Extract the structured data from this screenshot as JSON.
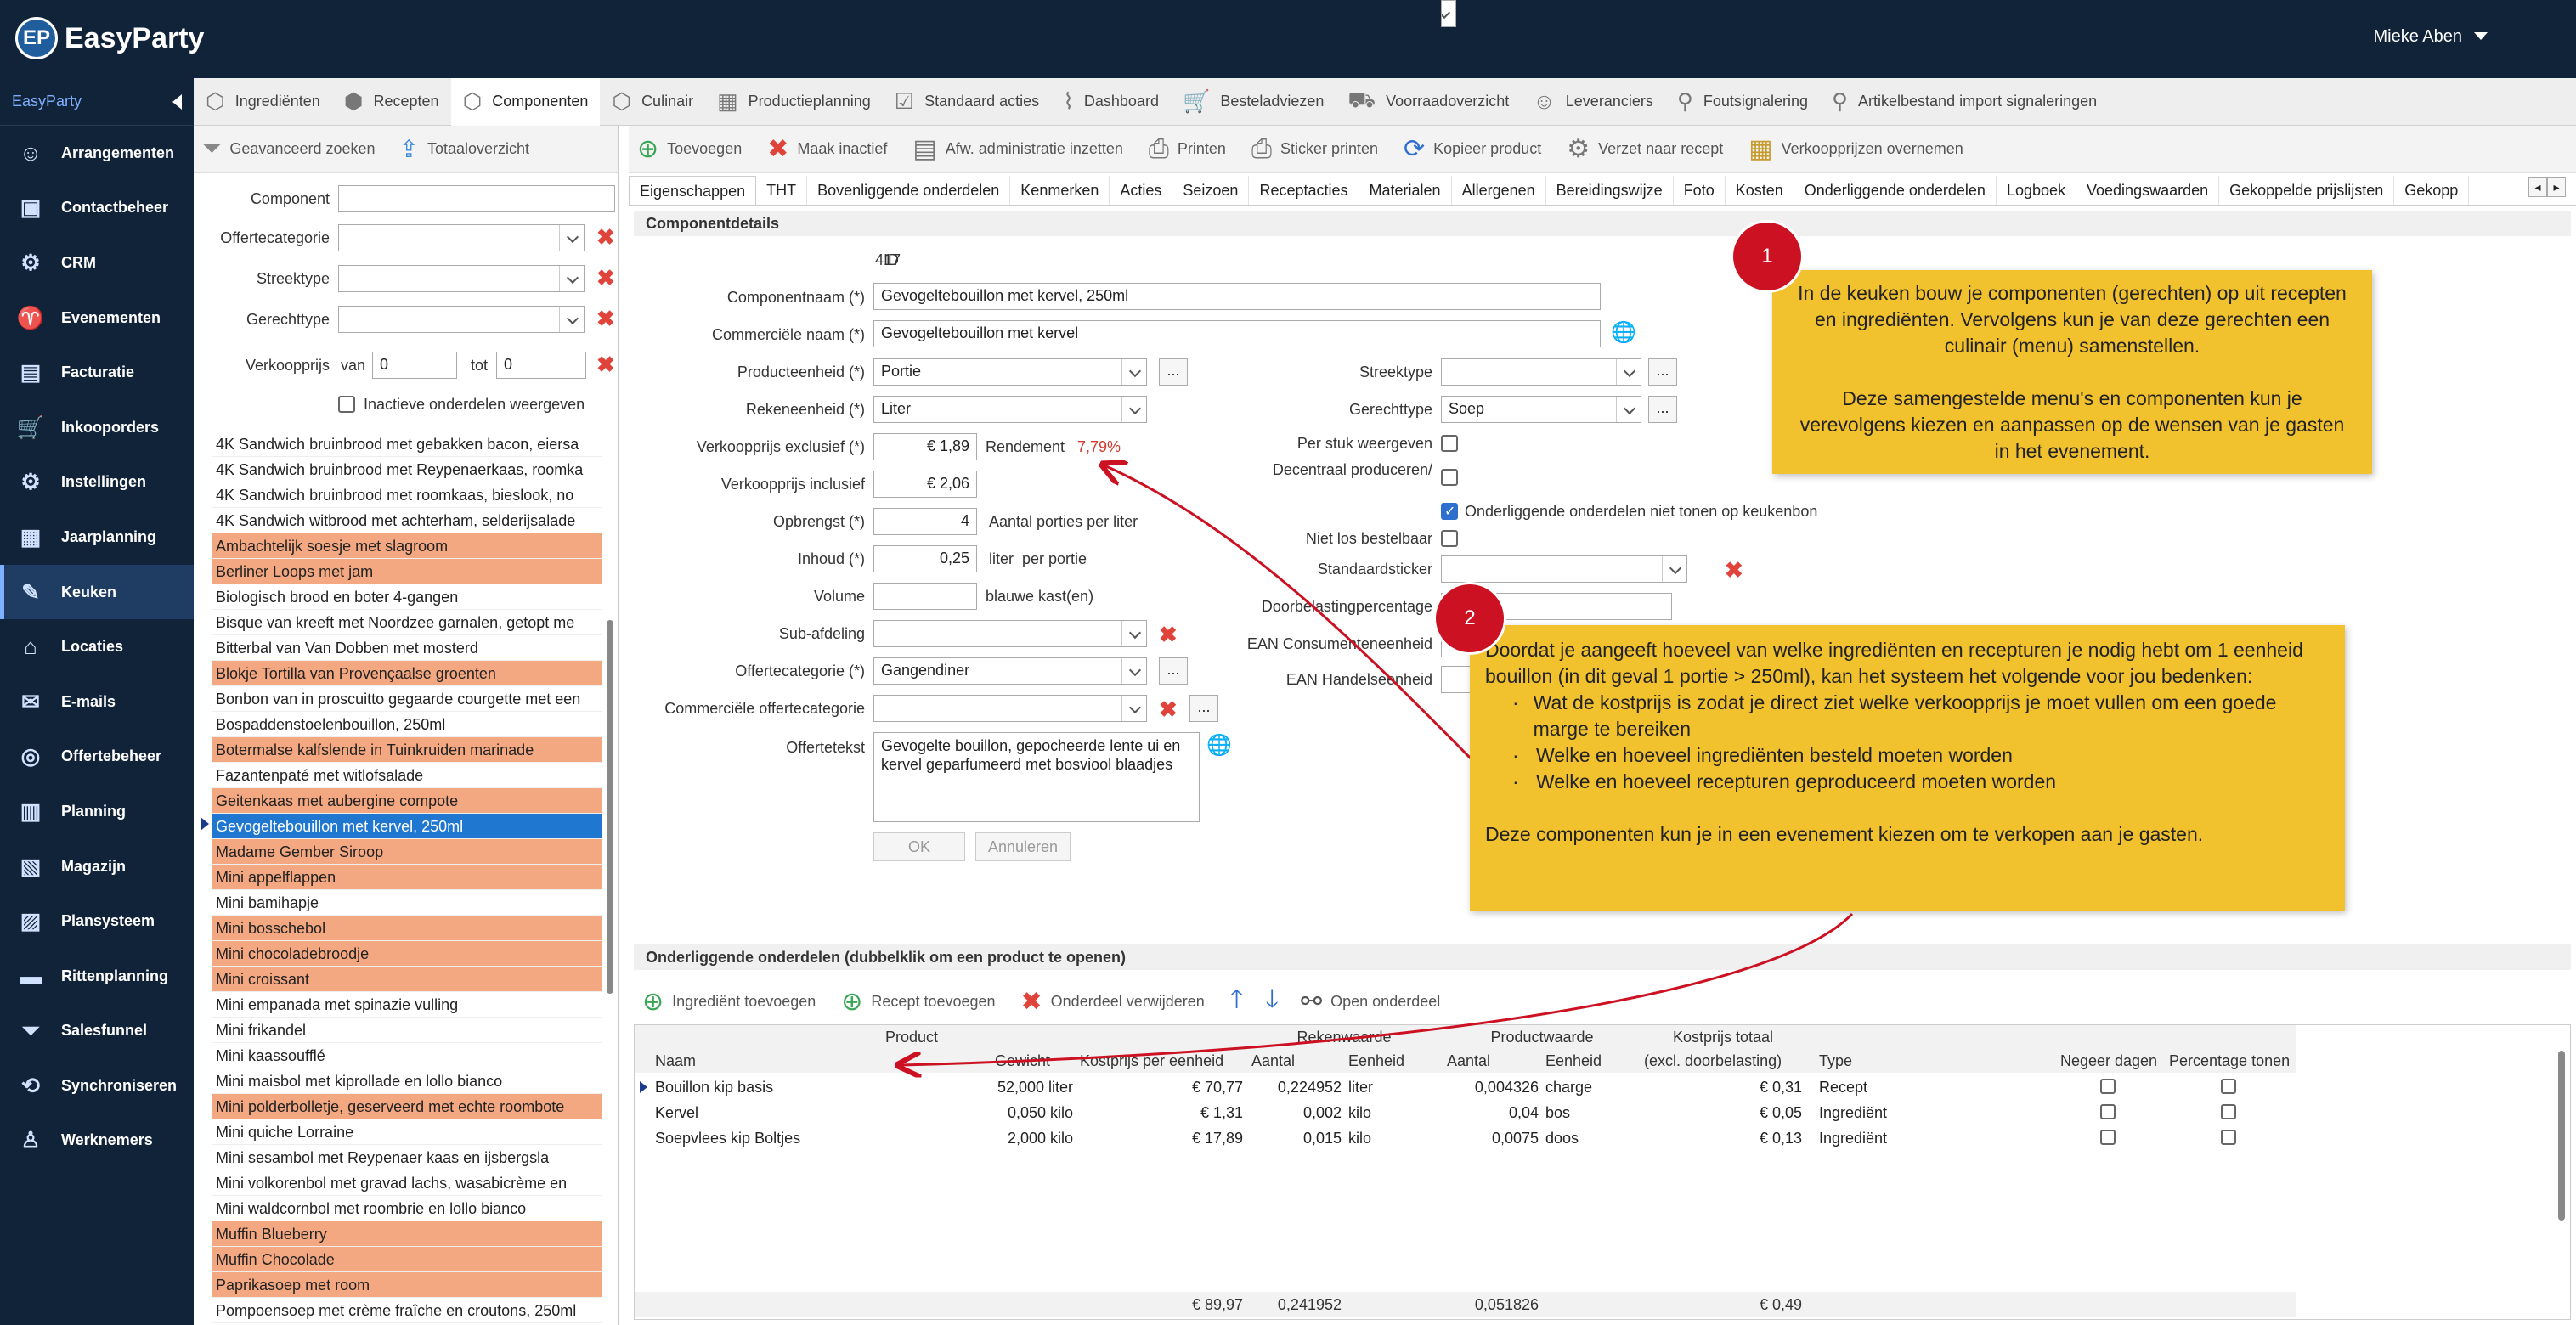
{
  "app": {
    "logo_badge": "EP",
    "logo_text": "EasyParty",
    "user": "Mieke Aben"
  },
  "sidebar": {
    "header": "EasyParty",
    "items": [
      {
        "label": "Arrangementen",
        "icon": "people-icon"
      },
      {
        "label": "Contactbeheer",
        "icon": "contact-card-icon"
      },
      {
        "label": "CRM",
        "icon": "crm-icon"
      },
      {
        "label": "Evenementen",
        "icon": "glass-icon"
      },
      {
        "label": "Facturatie",
        "icon": "invoice-icon"
      },
      {
        "label": "Inkooporders",
        "icon": "cart-icon"
      },
      {
        "label": "Instellingen",
        "icon": "gear-icon"
      },
      {
        "label": "Jaarplanning",
        "icon": "calendar-icon"
      },
      {
        "label": "Keuken",
        "icon": "knife-icon"
      },
      {
        "label": "Locaties",
        "icon": "house-icon"
      },
      {
        "label": "E-mails",
        "icon": "mail-icon"
      },
      {
        "label": "Offertebeheer",
        "icon": "quote-icon"
      },
      {
        "label": "Planning",
        "icon": "planning-icon"
      },
      {
        "label": "Magazijn",
        "icon": "box-icon"
      },
      {
        "label": "Plansysteem",
        "icon": "board-icon"
      },
      {
        "label": "Rittenplanning",
        "icon": "bus-icon"
      },
      {
        "label": "Salesfunnel",
        "icon": "funnel-icon"
      },
      {
        "label": "Synchroniseren",
        "icon": "sync-icon"
      },
      {
        "label": "Werknemers",
        "icon": "worker-icon"
      }
    ]
  },
  "module_tabs": [
    {
      "label": "Ingrediënten",
      "icon": "cube-icon"
    },
    {
      "label": "Recepten",
      "icon": "cubes-icon"
    },
    {
      "label": "Componenten",
      "icon": "cube-icon"
    },
    {
      "label": "Culinair",
      "icon": "cube-icon"
    },
    {
      "label": "Productieplanning",
      "icon": "calendar-icon"
    },
    {
      "label": "Standaard acties",
      "icon": "checklist-icon"
    },
    {
      "label": "Dashboard",
      "icon": "chart-icon"
    },
    {
      "label": "Besteladviezen",
      "icon": "cart-icon"
    },
    {
      "label": "Voorraadoverzicht",
      "icon": "forklift-icon"
    },
    {
      "label": "Leveranciers",
      "icon": "people-icon"
    },
    {
      "label": "Foutsignalering",
      "icon": "search-icon"
    },
    {
      "label": "Artikelbestand import signaleringen",
      "icon": "search-icon"
    }
  ],
  "left": {
    "tool": {
      "advanced": "Geavanceerd zoeken",
      "total": "Totaaloverzicht"
    },
    "filters": {
      "component": "Component",
      "offercat": "Offertecategorie",
      "streek": "Streektype",
      "gerecht": "Gerechttype",
      "price": "Verkoopprijs",
      "van": "van",
      "tot": "tot",
      "van_val": "0",
      "tot_val": "0",
      "inactive": "Inactieve onderdelen weergeven"
    },
    "items": [
      {
        "text": "4K Sandwich bruinbrood met gebakken bacon, eiersa",
        "hl": false
      },
      {
        "text": "4K Sandwich bruinbrood met Reypenaerkaas, roomka",
        "hl": false
      },
      {
        "text": "4K Sandwich bruinbrood met roomkaas, bieslook, no",
        "hl": false
      },
      {
        "text": "4K Sandwich witbrood met achterham, selderijsalade",
        "hl": false
      },
      {
        "text": "Ambachtelijk soesje met slagroom",
        "hl": true
      },
      {
        "text": "Berliner Loops met jam",
        "hl": true
      },
      {
        "text": "Biologisch brood en boter 4-gangen",
        "hl": false
      },
      {
        "text": "Bisque van kreeft met Noordzee garnalen, getopt me",
        "hl": false
      },
      {
        "text": "Bitterbal van Van Dobben met mosterd",
        "hl": false
      },
      {
        "text": "Blokje Tortilla van Provençaalse groenten",
        "hl": true
      },
      {
        "text": "Bonbon van in proscuitto gegaarde courgette met een",
        "hl": false
      },
      {
        "text": "Bospaddenstoelenbouillon, 250ml",
        "hl": false
      },
      {
        "text": "Botermalse kalfslende in Tuinkruiden marinade",
        "hl": true
      },
      {
        "text": "Fazantenpaté met witlofsalade",
        "hl": false
      },
      {
        "text": "Geitenkaas met aubergine compote",
        "hl": true
      },
      {
        "text": "Gevogeltebouillon met kervel, 250ml",
        "hl": false,
        "sel": true
      },
      {
        "text": "Madame Gember Siroop",
        "hl": true
      },
      {
        "text": "Mini appelflappen",
        "hl": true
      },
      {
        "text": "Mini bamihapje",
        "hl": false
      },
      {
        "text": "Mini bosschebol",
        "hl": true
      },
      {
        "text": "Mini chocoladebroodje",
        "hl": true
      },
      {
        "text": "Mini croissant",
        "hl": true
      },
      {
        "text": "Mini empanada met spinazie vulling",
        "hl": false
      },
      {
        "text": "Mini frikandel",
        "hl": false
      },
      {
        "text": "Mini kaassoufflé",
        "hl": false
      },
      {
        "text": "Mini maisbol met kiprollade en lollo bianco",
        "hl": false
      },
      {
        "text": "Mini polderbolletje, geserveerd met echte roombote",
        "hl": true
      },
      {
        "text": "Mini quiche Lorraine",
        "hl": false
      },
      {
        "text": "Mini sesambol met Reypenaer kaas en ijsbergsla",
        "hl": false
      },
      {
        "text": "Mini volkorenbol met gravad lachs, wasabicrème en",
        "hl": false
      },
      {
        "text": "Mini waldcornbol met roombrie en lollo bianco",
        "hl": false
      },
      {
        "text": "Muffin Blueberry",
        "hl": true
      },
      {
        "text": "Muffin Chocolade",
        "hl": true
      },
      {
        "text": "Paprikasoep met room",
        "hl": true
      },
      {
        "text": "Pompoensoep met crème fraîche en croutons, 250ml",
        "hl": false
      }
    ]
  },
  "toolbar": {
    "add": "Toevoegen",
    "inactive": "Maak inactief",
    "admin": "Afw. administratie inzetten",
    "print": "Printen",
    "sticker": "Sticker printen",
    "copy": "Kopieer product",
    "move": "Verzet naar recept",
    "prices": "Verkoopprijzen overnemen"
  },
  "subtabs": [
    "Eigenschappen",
    "THT",
    "Bovenliggende onderdelen",
    "Kenmerken",
    "Acties",
    "Seizoen",
    "Receptacties",
    "Materialen",
    "Allergenen",
    "Bereidingswijze",
    "Foto",
    "Kosten",
    "Onderliggende onderdelen",
    "Logboek",
    "Voedingswaarden",
    "Gekoppelde prijslijsten",
    "Gekopp"
  ],
  "details": {
    "section": "Componentdetails",
    "id_label": "ID",
    "id": "417",
    "name_label": "Componentnaam (*)",
    "name": "Gevogeltebouillon met kervel, 250ml",
    "comm_label": "Commerciële naam (*)",
    "comm": "Gevogeltebouillon met kervel",
    "prod_unit_label": "Producteenheid (*)",
    "prod_unit": "Portie",
    "calc_unit_label": "Rekeneenheid (*)",
    "calc_unit": "Liter",
    "price_ex_label": "Verkoopprijs exclusief (*)",
    "price_ex": "€ 1,89",
    "rend_label": "Rendement",
    "rend": "7,79%",
    "price_in_label": "Verkoopprijs inclusief",
    "price_in": "€ 2,06",
    "yield_label": "Opbrengst (*)",
    "yield": "4",
    "yield_unit": "Aantal porties per liter",
    "content_label": "Inhoud (*)",
    "content": "0,25",
    "content_unit": "liter  per portie",
    "volume_label": "Volume",
    "volume_unit": "blauwe kast(en)",
    "subdept_label": "Sub-afdeling",
    "offercat_label": "Offertecategorie (*)",
    "offercat": "Gangendiner",
    "commcat_label": "Commerciële offertecategorie",
    "text_label": "Offertetekst",
    "text": "Gevogelte bouillon, gepocheerde lente ui en kervel geparfumeerd met bosviool blaadjes",
    "ok": "OK",
    "cancel": "Annuleren",
    "streek_label": "Streektype",
    "gerecht_label": "Gerechttype",
    "gerecht": "Soep",
    "perstuk_label": "Per stuk weergeven",
    "decentraal_label": "Decentraal produceren/",
    "hide_label": "Onderliggende onderdelen niet tonen op keukenbon",
    "nietlos_label": "Niet los bestelbaar",
    "sticker_label": "Standaardsticker",
    "doorb_label": "Doorbelastingpercentage",
    "ean1_label": "EAN Consumenteneenheid",
    "ean2_label": "EAN Handelseenheid"
  },
  "notes": {
    "n1_badge": "1",
    "n1": "In de keuken bouw je componenten (gerechten) op uit recepten en ingrediënten. Vervolgens kun je van deze gerechten een culinair (menu) samenstellen.\n\nDeze samengestelde menu's en componenten kun je verevolgens kiezen en aanpassen op de wensen van je gasten in het evenement.",
    "n2_badge": "2",
    "n2_intro": "Doordat je aangeeft hoeveel van welke ingrediënten en recepturen je nodig hebt om 1 eenheid bouillon (in dit geval 1 portie > 250ml), kan het systeem het volgende voor jou bedenken:",
    "n2_b1": "Wat de kostprijs is zodat je direct ziet welke verkoopprijs je moet vullen om een goede marge te bereiken",
    "n2_b2": "Welke en hoeveel ingrediënten besteld moeten worden",
    "n2_b3": "Welke en hoeveel recepturen geproduceerd moeten worden",
    "n2_end": "Deze componenten kun je in een evenement kiezen om te verkopen aan je gasten."
  },
  "sub": {
    "section": "Onderliggende onderdelen (dubbelklik om een product te openen)",
    "add_ing": "Ingrediënt toevoegen",
    "add_rec": "Recept toevoegen",
    "remove": "Onderdeel verwijderen",
    "open": "Open onderdeel",
    "groups": {
      "product": "Product",
      "rek": "Rekenwaarde",
      "prod": "Productwaarde",
      "kost": "Kostprijs totaal"
    },
    "cols": [
      "Naam",
      "Gewicht",
      "Kostprijs per eenheid",
      "Aantal",
      "Eenheid",
      "Aantal",
      "Eenheid",
      "(excl. doorbelasting)",
      "Type",
      "Negeer dagen",
      "Percentage tonen"
    ],
    "rows": [
      [
        "Bouillon kip basis",
        "52,000 liter",
        "€ 70,77",
        "0,224952",
        "liter",
        "0,004326",
        "charge",
        "€ 0,31",
        "Recept"
      ],
      [
        "Kervel",
        "0,050 kilo",
        "€ 1,31",
        "0,002",
        "kilo",
        "0,04",
        "bos",
        "€ 0,05",
        "Ingrediënt"
      ],
      [
        "Soepvlees kip Boltjes",
        "2,000 kilo",
        "€ 17,89",
        "0,015",
        "kilo",
        "0,0075",
        "doos",
        "€ 0,13",
        "Ingrediënt"
      ]
    ],
    "totals": [
      "€ 89,97",
      "0,241952",
      "0,051826",
      "€ 0,49"
    ]
  },
  "colors": {
    "nav": "#102338",
    "highlight": "#f4a881",
    "selected": "#1f77d0",
    "note": "#f2c12e",
    "badge": "#cc1122",
    "arrow": "#cc1122"
  }
}
